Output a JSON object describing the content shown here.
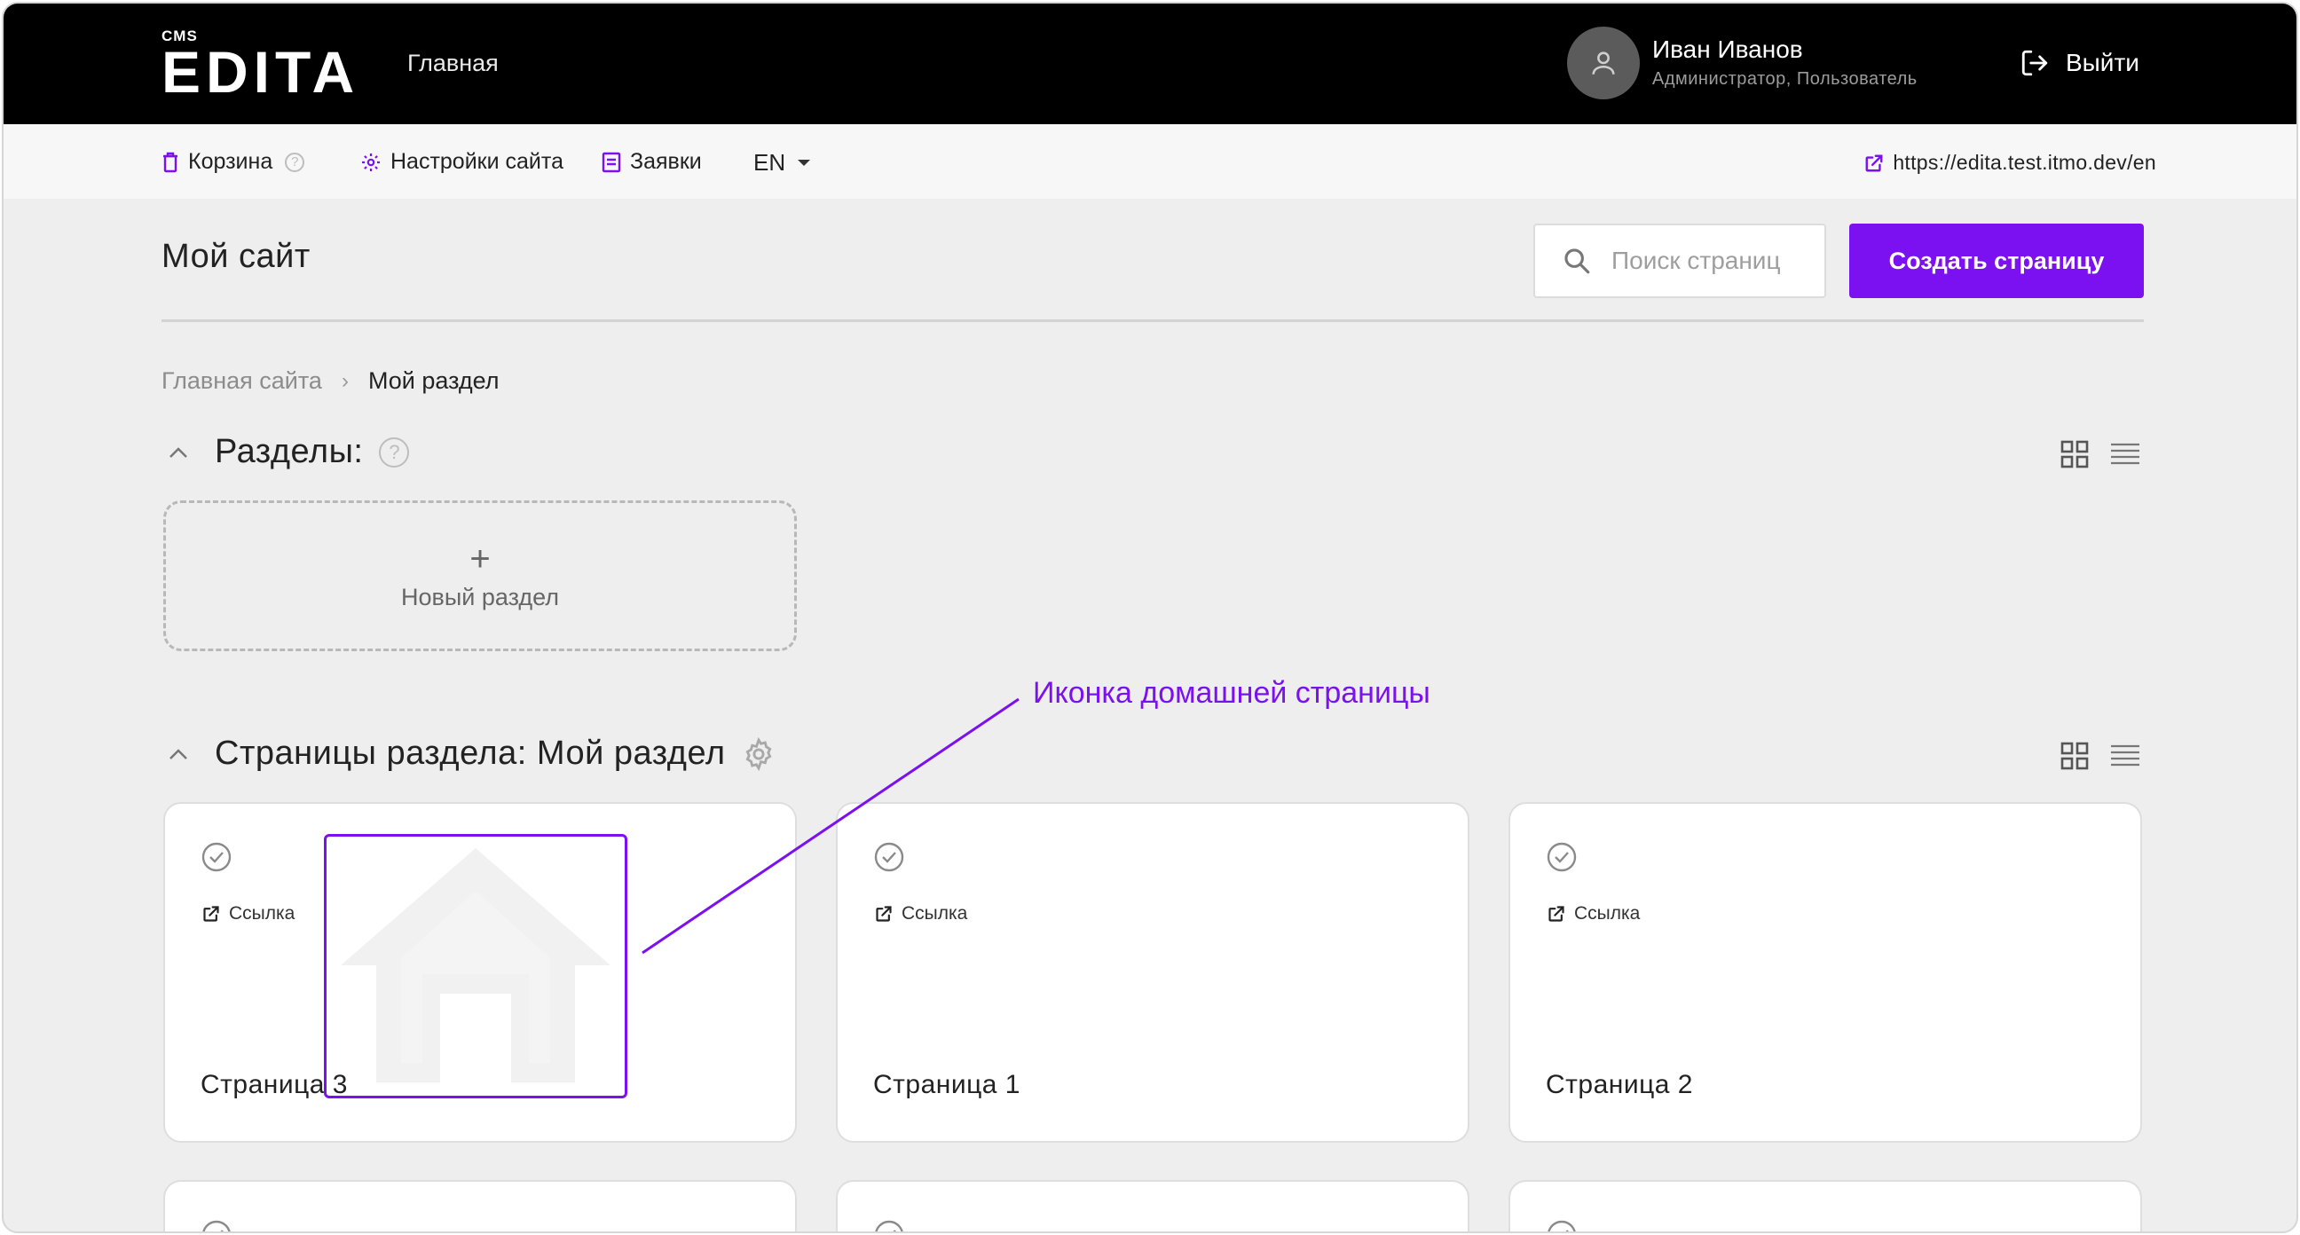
{
  "header": {
    "logo_small": "CMS",
    "logo_name": "EDITA",
    "nav_home": "Главная",
    "user_name": "Иван Иванов",
    "user_roles": "Администратор, Пользователь",
    "logout_label": "Выйти"
  },
  "toolbar": {
    "trash_label": "Корзина",
    "help_glyph": "?",
    "settings_label": "Настройки сайта",
    "requests_label": "Заявки",
    "language": "EN",
    "site_url": "https://edita.test.itmo.dev/en"
  },
  "page": {
    "title": "Мой сайт",
    "search_placeholder": "Поиск страниц",
    "create_button": "Создать страницу"
  },
  "breadcrumb": {
    "root": "Главная сайта",
    "separator": "›",
    "current": "Мой раздел"
  },
  "sections": {
    "title": "Разделы:",
    "help_glyph": "?",
    "new_section_plus": "+",
    "new_section_label": "Новый раздел"
  },
  "pages": {
    "title": "Страницы раздела: Мой раздел",
    "cards": [
      {
        "link_label": "Ссылка",
        "title": "Страница 3",
        "is_home": true
      },
      {
        "link_label": "Ссылка",
        "title": "Страница 1",
        "is_home": false
      },
      {
        "link_label": "Ссылка",
        "title": "Страница 2",
        "is_home": false
      }
    ]
  },
  "annotation": {
    "label": "Иконка домашней страницы"
  },
  "colors": {
    "accent": "#7b10f0",
    "header_bg": "#000000",
    "page_bg": "#eeeeee"
  }
}
